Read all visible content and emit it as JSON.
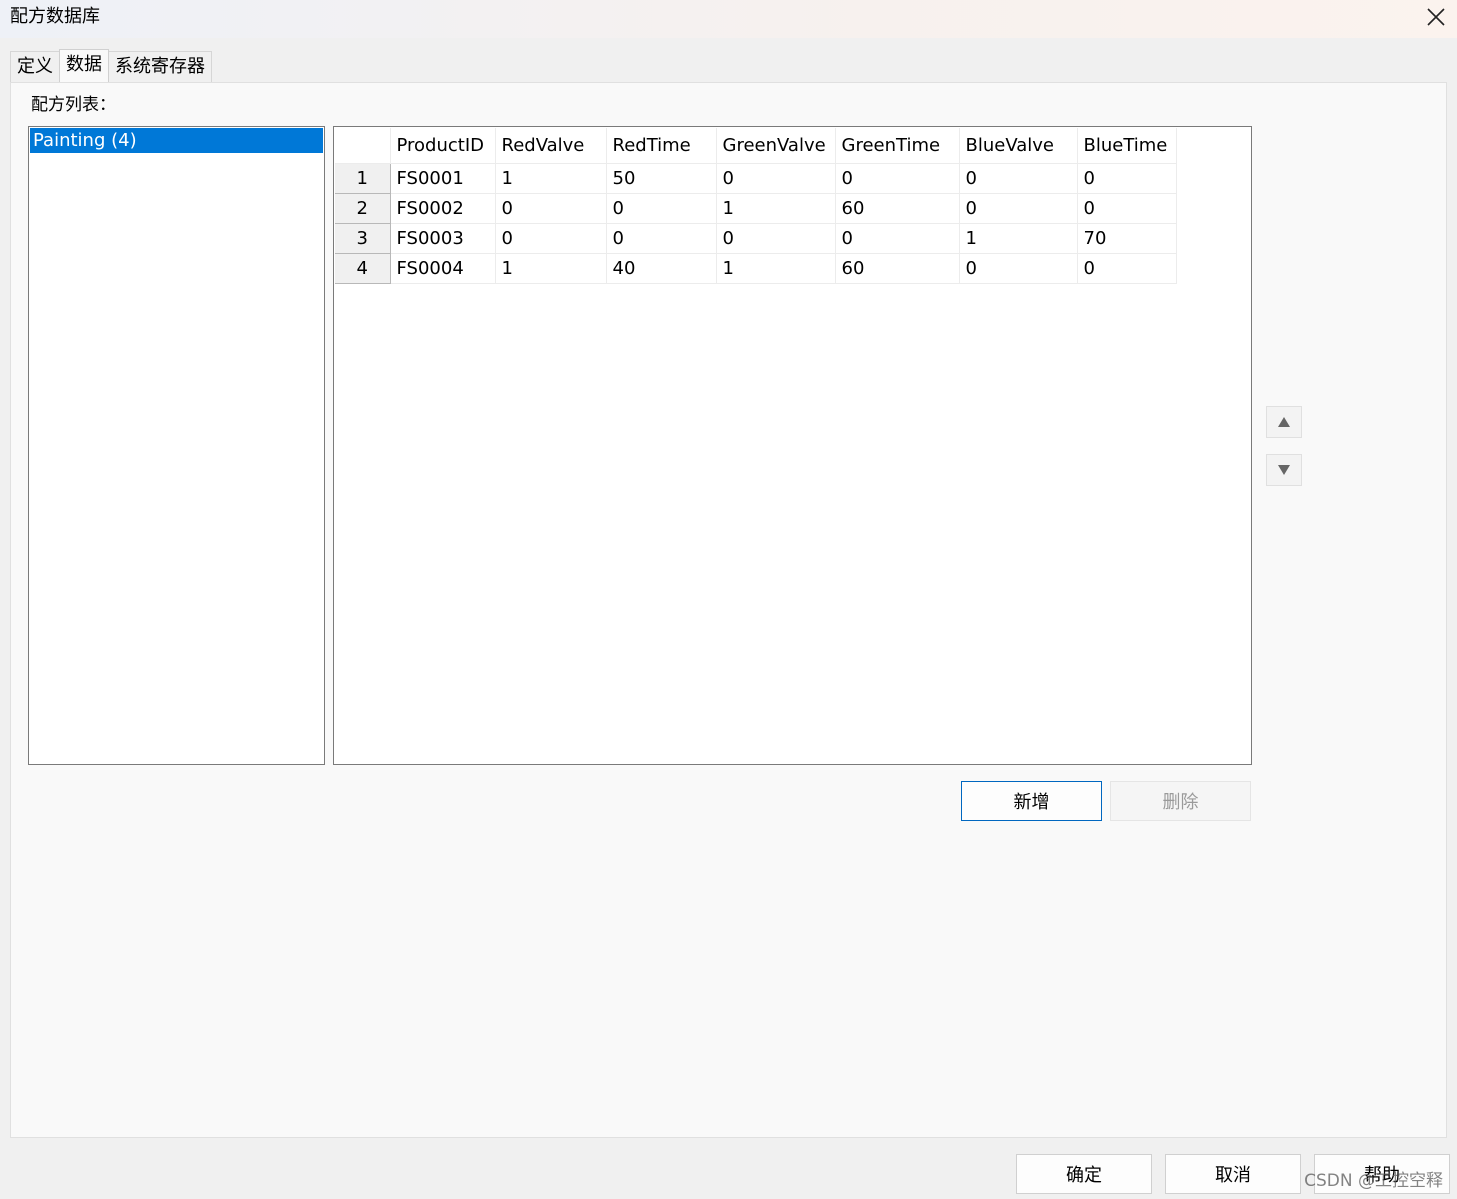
{
  "window": {
    "title": "配方数据库"
  },
  "tabs": [
    {
      "label": "定义",
      "active": false
    },
    {
      "label": "数据",
      "active": true
    },
    {
      "label": "系统寄存器",
      "active": false
    }
  ],
  "recipe_list": {
    "label": "配方列表：",
    "items": [
      {
        "label": "Painting (4)",
        "selected": true
      }
    ]
  },
  "grid": {
    "columns": [
      "ProductID",
      "RedValve",
      "RedTime",
      "GreenValve",
      "GreenTime",
      "BlueValve",
      "BlueTime"
    ],
    "rows": [
      {
        "index": "1",
        "cells": [
          "FS0001",
          "1",
          "50",
          "0",
          "0",
          "0",
          "0"
        ]
      },
      {
        "index": "2",
        "cells": [
          "FS0002",
          "0",
          "0",
          "1",
          "60",
          "0",
          "0"
        ]
      },
      {
        "index": "3",
        "cells": [
          "FS0003",
          "0",
          "0",
          "0",
          "0",
          "1",
          "70"
        ]
      },
      {
        "index": "4",
        "cells": [
          "FS0004",
          "1",
          "40",
          "1",
          "60",
          "0",
          "0"
        ]
      }
    ]
  },
  "actions": {
    "add_label": "新增",
    "delete_label": "删除"
  },
  "footer": {
    "ok_label": "确定",
    "cancel_label": "取消",
    "help_label": "帮助"
  },
  "watermark": "CSDN @工控空释",
  "colors": {
    "selection": "#0078d7",
    "primary_border": "#0067c0"
  }
}
